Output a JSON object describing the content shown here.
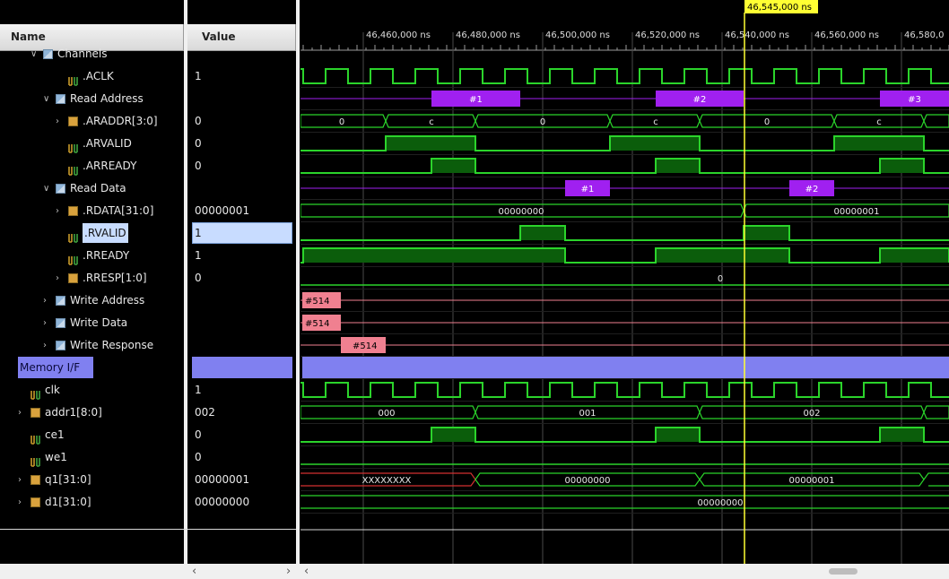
{
  "header": {
    "name_label": "Name",
    "value_label": "Value"
  },
  "cursor": {
    "label": "46,545,000 ns",
    "time_ns": 46545000
  },
  "timeline": {
    "ticks": [
      "46,460,000 ns",
      "46,480,000 ns",
      "46,500,000 ns",
      "46,520,000 ns",
      "46,540,000 ns",
      "46,560,000 ns",
      "46,580,0"
    ]
  },
  "rows": [
    {
      "name": "Channels",
      "value": "",
      "indent": 2,
      "chev": "v",
      "icon": "grp"
    },
    {
      "name": ".ACLK",
      "value": "1",
      "indent": 4,
      "chev": "",
      "icon": "sig"
    },
    {
      "name": "Read Address",
      "value": "",
      "indent": 3,
      "chev": "v",
      "icon": "grp"
    },
    {
      "name": ".ARADDR[3:0]",
      "value": "0",
      "indent": 4,
      "chev": ">",
      "icon": "bus"
    },
    {
      "name": ".ARVALID",
      "value": "0",
      "indent": 4,
      "chev": "",
      "icon": "sig"
    },
    {
      "name": ".ARREADY",
      "value": "0",
      "indent": 4,
      "chev": "",
      "icon": "sig"
    },
    {
      "name": "Read Data",
      "value": "",
      "indent": 3,
      "chev": "v",
      "icon": "grp"
    },
    {
      "name": ".RDATA[31:0]",
      "value": "00000001",
      "indent": 4,
      "chev": ">",
      "icon": "bus"
    },
    {
      "name": ".RVALID",
      "value": "1",
      "indent": 4,
      "chev": "",
      "icon": "sig",
      "selected": true
    },
    {
      "name": ".RREADY",
      "value": "1",
      "indent": 4,
      "chev": "",
      "icon": "sig"
    },
    {
      "name": ".RRESP[1:0]",
      "value": "0",
      "indent": 4,
      "chev": ">",
      "icon": "bus"
    },
    {
      "name": "Write Address",
      "value": "",
      "indent": 3,
      "chev": ">",
      "icon": "grp"
    },
    {
      "name": "Write Data",
      "value": "",
      "indent": 3,
      "chev": ">",
      "icon": "grp"
    },
    {
      "name": "Write Response",
      "value": "",
      "indent": 3,
      "chev": ">",
      "icon": "grp"
    },
    {
      "name": "Memory I/F",
      "value": "",
      "indent": 0,
      "chev": "",
      "icon": "",
      "divider": true
    },
    {
      "name": "clk",
      "value": "1",
      "indent": 1,
      "chev": "",
      "icon": "sig"
    },
    {
      "name": "addr1[8:0]",
      "value": "002",
      "indent": 1,
      "chev": ">",
      "icon": "bus"
    },
    {
      "name": "ce1",
      "value": "0",
      "indent": 1,
      "chev": "",
      "icon": "sig"
    },
    {
      "name": "we1",
      "value": "0",
      "indent": 1,
      "chev": "",
      "icon": "sig"
    },
    {
      "name": "q1[31:0]",
      "value": "00000001",
      "indent": 1,
      "chev": ">",
      "icon": "bus"
    },
    {
      "name": "d1[31:0]",
      "value": "00000000",
      "indent": 1,
      "chev": ">",
      "icon": "bus"
    }
  ],
  "waves": {
    "araddr_labels": [
      "0",
      "c",
      "0",
      "c",
      "0",
      "c"
    ],
    "rdata_labels": [
      "00000000",
      "00000001"
    ],
    "rresp_label": "0",
    "addr_txn_labels": [
      "#1",
      "#2",
      "#3"
    ],
    "data_txn_labels": [
      "#1",
      "#2"
    ],
    "write_labels": [
      "#514",
      "#514",
      "#514"
    ],
    "addr1_labels": [
      "000",
      "001",
      "002"
    ],
    "q1_labels": [
      "XXXXXXXX",
      "00000000",
      "00000001"
    ],
    "d1_label": "00000000"
  },
  "colors": {
    "wave_green": "#2bd42b",
    "bus_fill": "#0b5d0b",
    "txn_purple": "#a020f0",
    "write_pink": "#f08090",
    "divider": "#8080f0",
    "cursor": "#ffff33",
    "selected_row": "#c8dcff"
  }
}
